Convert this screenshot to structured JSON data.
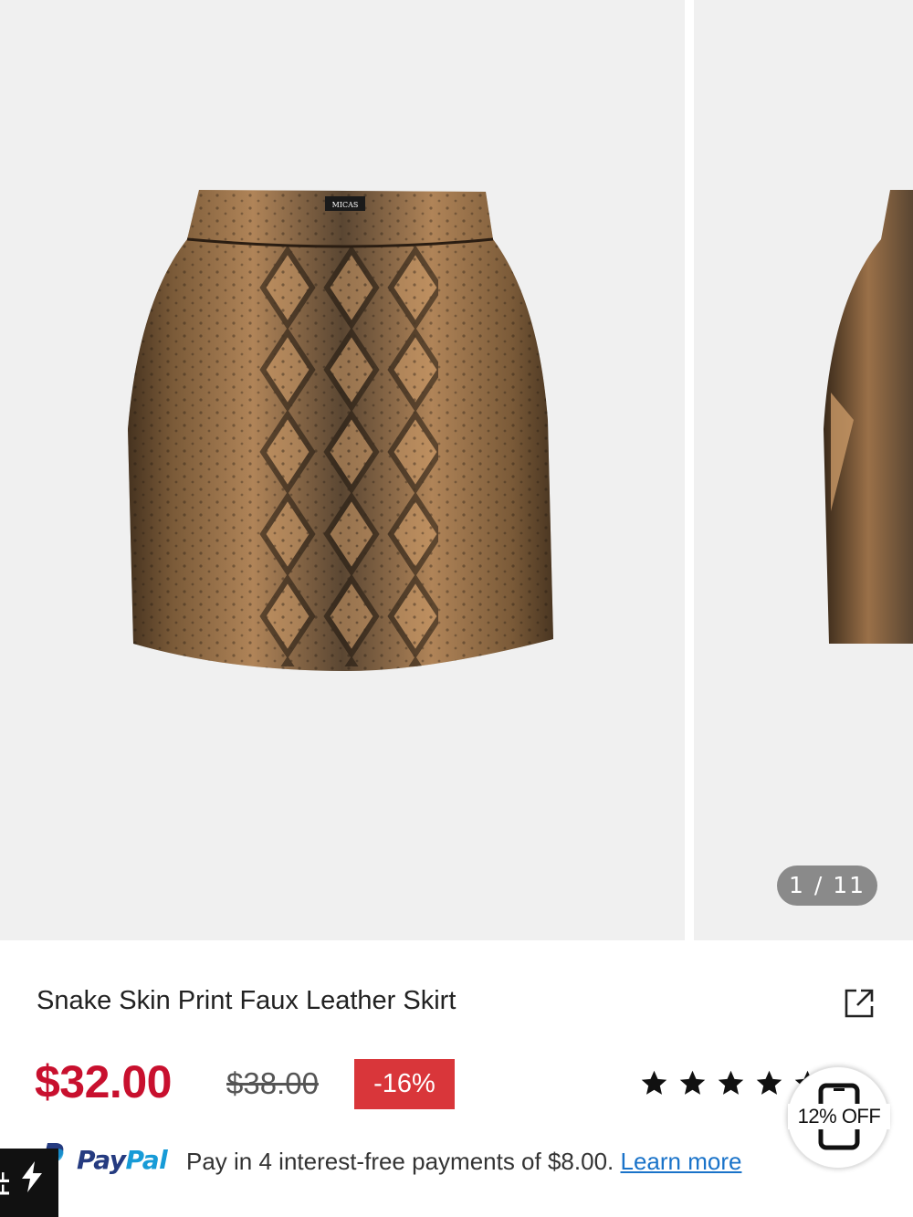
{
  "gallery": {
    "counter": "1 / 11",
    "current_index": 1,
    "total_images": 11
  },
  "product": {
    "title": "Snake Skin Print Faux Leather Skirt",
    "price": "$32.00",
    "original_price": "$38.00",
    "discount": "-16%",
    "rating_stars": 5,
    "brand_label": "MICAS"
  },
  "promo_badge": {
    "label": "12% OFF",
    "icon": "phone-icon"
  },
  "paypal": {
    "logo_part1": "Pay",
    "logo_part2": "Pal",
    "message": "Pay in 4 interest-free payments of $8.00.",
    "link": "Learn more"
  },
  "flash_tab": {
    "label": "FF",
    "icon": "lightning-icon"
  },
  "colors": {
    "price_red": "#c8102e",
    "discount_red": "#d9363a",
    "link_blue": "#1a73c9",
    "paypal_dark": "#253b80",
    "paypal_light": "#179bd7",
    "image_background": "#f0f0f0"
  }
}
